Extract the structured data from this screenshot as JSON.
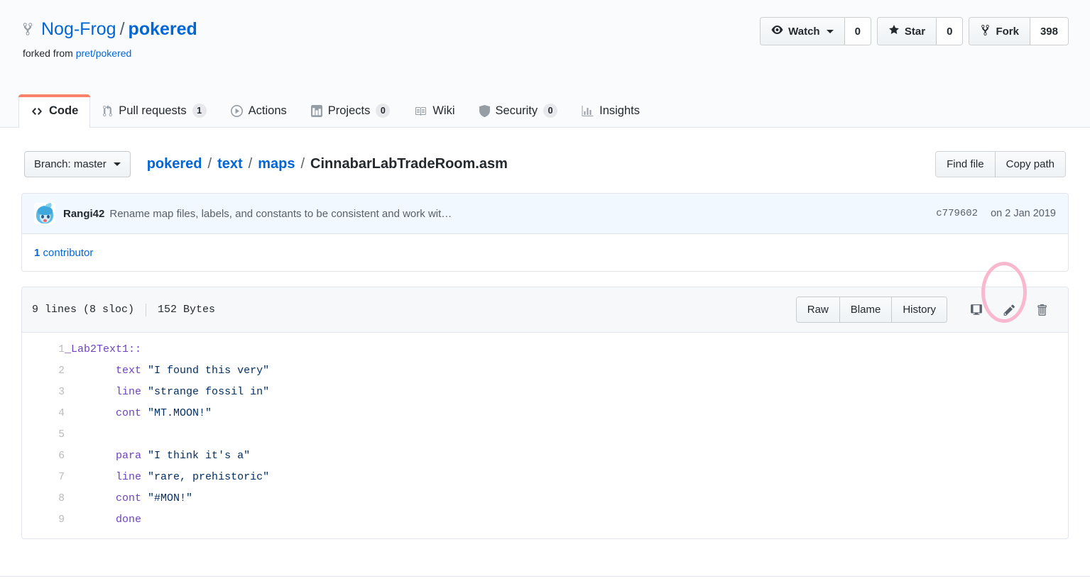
{
  "repo": {
    "owner": "Nog-Frog",
    "separator": "/",
    "name": "pokered",
    "forked_label": "forked from",
    "forked_from": "pret/pokered",
    "fork_icon": "repo-forked-icon"
  },
  "actions": {
    "watch": {
      "label": "Watch",
      "count": "0",
      "icon": "eye-icon"
    },
    "star": {
      "label": "Star",
      "count": "0",
      "icon": "star-icon"
    },
    "fork": {
      "label": "Fork",
      "count": "398",
      "icon": "repo-forked-icon"
    }
  },
  "tabs": [
    {
      "label": "Code",
      "icon": "code-icon",
      "count": null,
      "selected": true
    },
    {
      "label": "Pull requests",
      "icon": "git-pull-request-icon",
      "count": "1",
      "selected": false
    },
    {
      "label": "Actions",
      "icon": "play-icon",
      "count": null,
      "selected": false
    },
    {
      "label": "Projects",
      "icon": "project-board-icon",
      "count": "0",
      "selected": false
    },
    {
      "label": "Wiki",
      "icon": "book-icon",
      "count": null,
      "selected": false
    },
    {
      "label": "Security",
      "icon": "shield-icon",
      "count": "0",
      "selected": false
    },
    {
      "label": "Insights",
      "icon": "graph-icon",
      "count": null,
      "selected": false
    }
  ],
  "file_nav": {
    "branch_button": "Branch: master",
    "breadcrumb": {
      "root": "pokered",
      "segments": [
        "text",
        "maps"
      ],
      "filename": "CinnabarLabTradeRoom.asm",
      "separator": "/"
    },
    "find_file": "Find file",
    "copy_path": "Copy path"
  },
  "commit": {
    "author": "Rangi42",
    "message": "Rename map files, labels, and constants to be consistent and work wit…",
    "sha": "c779602",
    "date": "on 2 Jan 2019",
    "avatar_icon": "avatar"
  },
  "contributors": {
    "count": "1",
    "label": " contributor"
  },
  "file_meta": {
    "lines": "9 lines (8 sloc)",
    "size": "152 Bytes",
    "raw": "Raw",
    "blame": "Blame",
    "history": "History",
    "desktop_icon": "desktop-download-icon",
    "edit_icon": "pencil-icon",
    "delete_icon": "trash-icon",
    "highlight_color": "#f9b8cd"
  },
  "code": {
    "colors": {
      "keyword": "#6f42c1",
      "string": "#032f62",
      "text": "#24292e",
      "line_number": "#babbbd"
    },
    "lines": [
      {
        "num": "1",
        "tokens": [
          {
            "t": "label",
            "v": "_Lab2Text1::"
          }
        ]
      },
      {
        "num": "2",
        "tokens": [
          {
            "t": "plain",
            "v": "\tt"
          },
          {
            "t": "kw",
            "v": "text"
          },
          {
            "t": "plain",
            "v": " "
          },
          {
            "t": "str",
            "v": "\"I found this very\""
          }
        ]
      },
      {
        "num": "3",
        "tokens": [
          {
            "t": "kw",
            "v": "line"
          },
          {
            "t": "plain",
            "v": " "
          },
          {
            "t": "str",
            "v": "\"strange fossil in\""
          }
        ]
      },
      {
        "num": "4",
        "tokens": [
          {
            "t": "kw",
            "v": "cont"
          },
          {
            "t": "plain",
            "v": " "
          },
          {
            "t": "str",
            "v": "\"MT.MOON!\""
          }
        ]
      },
      {
        "num": "5",
        "tokens": []
      },
      {
        "num": "6",
        "tokens": [
          {
            "t": "kw",
            "v": "para"
          },
          {
            "t": "plain",
            "v": " "
          },
          {
            "t": "str",
            "v": "\"I think it's a\""
          }
        ]
      },
      {
        "num": "7",
        "tokens": [
          {
            "t": "kw",
            "v": "line"
          },
          {
            "t": "plain",
            "v": " "
          },
          {
            "t": "str",
            "v": "\"rare, prehistoric\""
          }
        ]
      },
      {
        "num": "8",
        "tokens": [
          {
            "t": "kw",
            "v": "cont"
          },
          {
            "t": "plain",
            "v": " "
          },
          {
            "t": "str",
            "v": "\"#MON!\""
          }
        ]
      },
      {
        "num": "9",
        "tokens": [
          {
            "t": "kw",
            "v": "done"
          }
        ]
      }
    ],
    "raw_lines": [
      "_Lab2Text1::",
      "\ttext \"I found this very\"",
      "\tline \"strange fossil in\"",
      "\tcont \"MT.MOON!\"",
      "",
      "\tpara \"I think it's a\"",
      "\tline \"rare, prehistoric\"",
      "\tcont \"#MON!\"",
      "\tdone"
    ]
  }
}
